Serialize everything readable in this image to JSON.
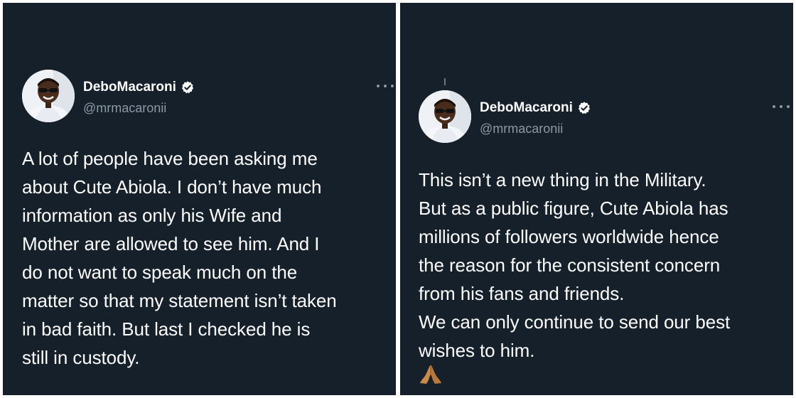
{
  "tweets": [
    {
      "display_name": "DeboMacaroni",
      "handle": "@mrmacaronii",
      "verified": true,
      "verified_icon": "verified-badge-icon",
      "more_icon": "more-options-icon",
      "text": "A lot of people have been asking me\nabout Cute Abiola. I don’t have much\ninformation as only his Wife and\nMother are allowed to see him. And I\ndo not want to speak much on the\nmatter so that my statement isn’t taken\nin bad faith. But last I checked he is\nstill in custody."
    },
    {
      "display_name": "DeboMacaroni",
      "handle": "@mrmacaronii",
      "verified": true,
      "verified_icon": "verified-badge-icon",
      "more_icon": "more-options-icon",
      "text": "This isn’t a new thing in the Military.\nBut as a public figure, Cute Abiola has\nmillions of followers worldwide hence\nthe reason for the consistent concern\nfrom his fans and friends.\nWe can only continue to send our best\nwishes to him.",
      "emoji": "folded-hands-emoji"
    }
  ],
  "colors": {
    "background": "#15202b",
    "text": "#ffffff",
    "muted": "#8b98a5",
    "divider": "#ffffff"
  }
}
